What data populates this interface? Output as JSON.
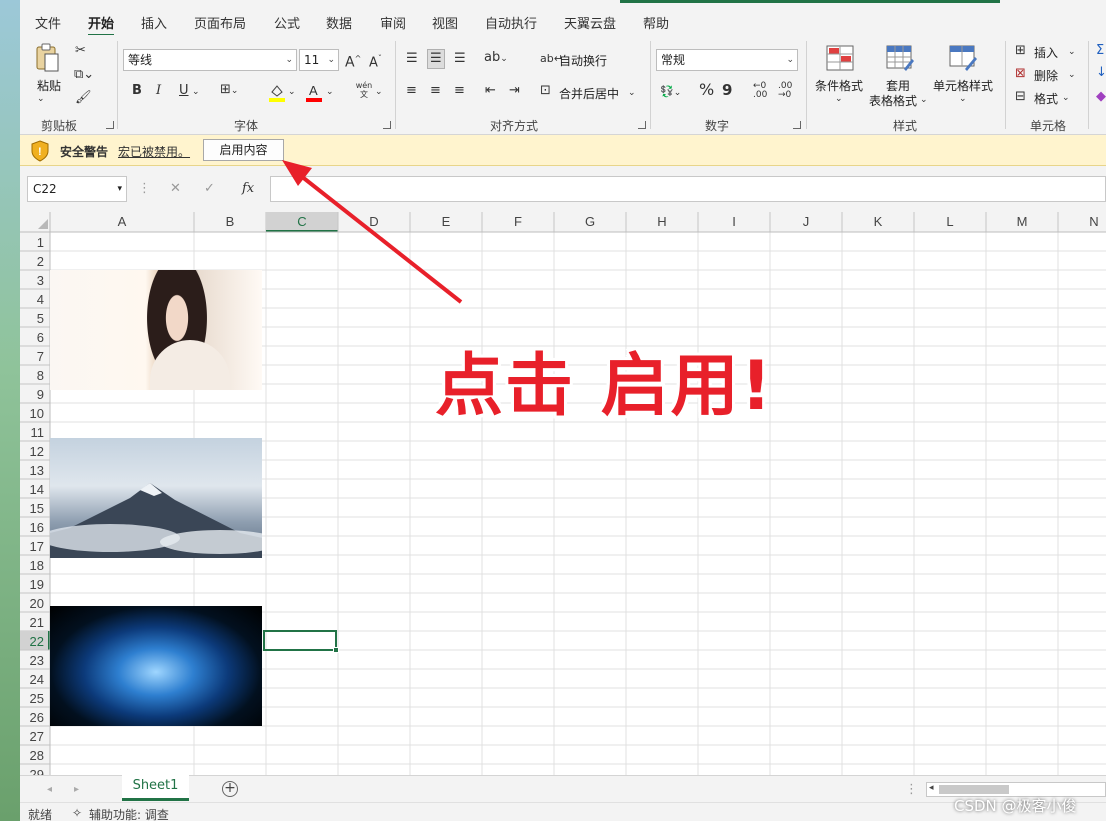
{
  "ribbon_tabs": [
    "文件",
    "开始",
    "插入",
    "页面布局",
    "公式",
    "数据",
    "审阅",
    "视图",
    "自动执行",
    "天翼云盘",
    "帮助"
  ],
  "active_tab": "开始",
  "clipboard": {
    "paste": "粘贴",
    "group": "剪贴板"
  },
  "font": {
    "name": "等线",
    "size": "11",
    "grow": "A^",
    "shrink": "A˅",
    "bold": "B",
    "italic": "I",
    "underline": "U",
    "phonetic_top": "wén",
    "phonetic_bottom": "文",
    "group": "字体"
  },
  "alignment": {
    "wrap": "自动换行",
    "merge": "合并后居中",
    "group": "对齐方式"
  },
  "number": {
    "format": "常规",
    "percent": "%",
    "comma": "9",
    "group": "数字"
  },
  "styles": {
    "cond": "条件格式",
    "table_1": "套用",
    "table_2": "表格格式",
    "cell": "单元格样式",
    "group": "样式"
  },
  "cells": {
    "insert": "插入",
    "delete": "删除",
    "format": "格式",
    "group": "单元格"
  },
  "security": {
    "title": "安全警告",
    "message": "宏已被禁用。",
    "button": "启用内容"
  },
  "formula_bar": {
    "name_box": "C22",
    "fx": "fx",
    "value": ""
  },
  "columns": [
    "A",
    "B",
    "C",
    "D",
    "E",
    "F",
    "G",
    "H",
    "I",
    "J",
    "K",
    "L",
    "M",
    "N"
  ],
  "rows": [
    "1",
    "2",
    "3",
    "4",
    "5",
    "6",
    "7",
    "8",
    "9",
    "10",
    "11",
    "12",
    "13",
    "14",
    "15",
    "16",
    "17",
    "18",
    "19",
    "20",
    "21",
    "22",
    "23",
    "24",
    "25",
    "26",
    "27",
    "28",
    "29"
  ],
  "active_cell": "C22",
  "images": [
    {
      "name": "portrait-photo",
      "anchor": "A3:B8"
    },
    {
      "name": "mountain-photo",
      "anchor": "A12:B17"
    },
    {
      "name": "galaxy-photo",
      "anchor": "A21:B26"
    }
  ],
  "annotation": {
    "text": "点击 启用!",
    "color": "#e8202a"
  },
  "sheet_tabs": [
    "Sheet1"
  ],
  "status": {
    "ready": "就绪",
    "accessibility": "辅助功能: 调查"
  },
  "watermark": "CSDN @极客小俊",
  "colors": {
    "accent": "#217346",
    "font_highlight": "#ffff00",
    "font_color": "#ff0000",
    "warning_bg": "#fff4ce",
    "annotation": "#e8202a"
  }
}
